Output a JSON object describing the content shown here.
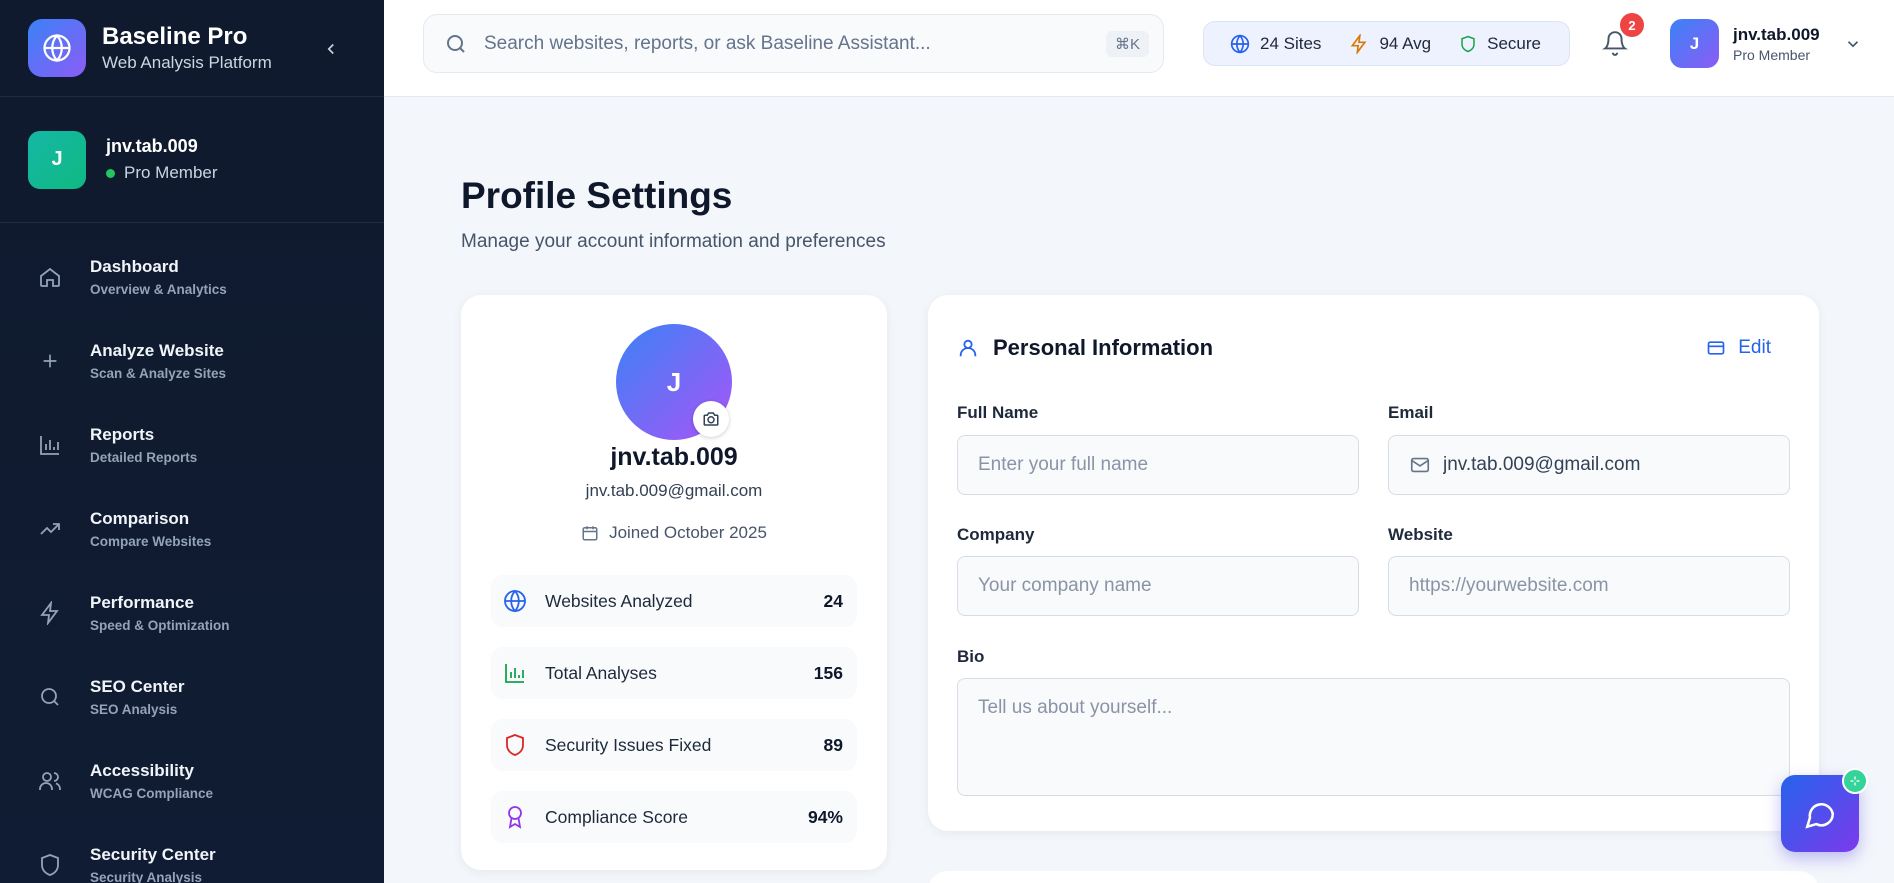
{
  "brand": {
    "name": "Baseline Pro",
    "tagline": "Web Analysis Platform"
  },
  "sidebar": {
    "user": {
      "initial": "J",
      "name": "jnv.tab.009",
      "status": "Pro Member"
    },
    "items": [
      {
        "label": "Dashboard",
        "sub": "Overview & Analytics",
        "icon": "home-icon"
      },
      {
        "label": "Analyze Website",
        "sub": "Scan & Analyze Sites",
        "icon": "plus-icon"
      },
      {
        "label": "Reports",
        "sub": "Detailed Reports",
        "icon": "bar-chart-icon"
      },
      {
        "label": "Comparison",
        "sub": "Compare Websites",
        "icon": "trending-up-icon"
      },
      {
        "label": "Performance",
        "sub": "Speed & Optimization",
        "icon": "lightning-icon"
      },
      {
        "label": "SEO Center",
        "sub": "SEO Analysis",
        "icon": "search-icon"
      },
      {
        "label": "Accessibility",
        "sub": "WCAG Compliance",
        "icon": "users-icon"
      },
      {
        "label": "Security Center",
        "sub": "Security Analysis",
        "icon": "shield-icon"
      }
    ]
  },
  "topbar": {
    "search_placeholder": "Search websites, reports, or ask Baseline Assistant...",
    "shortcut": "⌘K",
    "stats": {
      "sites": "24 Sites",
      "avg": "94 Avg",
      "secure": "Secure"
    },
    "notifications": "2",
    "user": {
      "initial": "J",
      "name": "jnv.tab.009",
      "role": "Pro Member"
    }
  },
  "page": {
    "title": "Profile Settings",
    "subtitle": "Manage your account information and preferences"
  },
  "profile": {
    "initial": "J",
    "name": "jnv.tab.009",
    "email": "jnv.tab.009@gmail.com",
    "joined": "Joined October 2025",
    "stats": [
      {
        "label": "Websites Analyzed",
        "value": "24"
      },
      {
        "label": "Total Analyses",
        "value": "156"
      },
      {
        "label": "Security Issues Fixed",
        "value": "89"
      },
      {
        "label": "Compliance Score",
        "value": "94%"
      }
    ]
  },
  "personal": {
    "title": "Personal Information",
    "edit": "Edit",
    "fields": {
      "full_name": {
        "label": "Full Name",
        "placeholder": "Enter your full name",
        "value": ""
      },
      "email": {
        "label": "Email",
        "value": "jnv.tab.009@gmail.com"
      },
      "company": {
        "label": "Company",
        "placeholder": "Your company name",
        "value": ""
      },
      "website": {
        "label": "Website",
        "placeholder": "https://yourwebsite.com",
        "value": ""
      },
      "bio": {
        "label": "Bio",
        "placeholder": "Tell us about yourself...",
        "value": ""
      }
    }
  },
  "colors": {
    "accent": "#2563eb",
    "brand_start": "#3b82f6",
    "brand_end": "#8b5cf6",
    "sidebar_bg": "#0f1a2e",
    "success": "#22c55e",
    "danger": "#ef4444"
  }
}
